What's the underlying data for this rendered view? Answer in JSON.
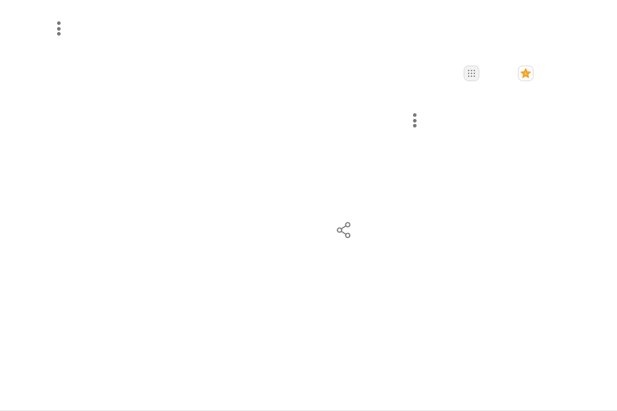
{
  "icons": {
    "top_menu": "more-options-icon",
    "apps": "apps-icon",
    "favorites": "star-icon",
    "mid_menu": "more-options-icon",
    "share": "share-icon"
  },
  "colors": {
    "background": "#ffffff",
    "icon_gray": "#777777",
    "star_fill": "#f5a623",
    "star_tile": "#fff6e0"
  }
}
